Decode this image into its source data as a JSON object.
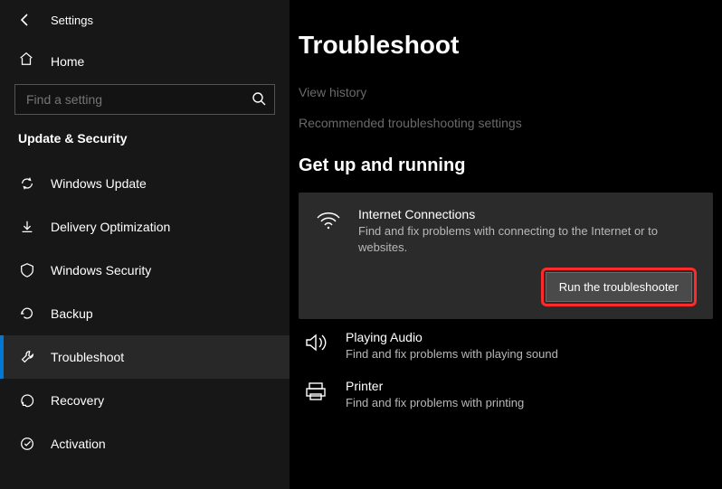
{
  "header": {
    "title": "Settings"
  },
  "home_label": "Home",
  "search": {
    "placeholder": "Find a setting"
  },
  "category": "Update & Security",
  "sidebar": {
    "items": [
      {
        "label": "Windows Update"
      },
      {
        "label": "Delivery Optimization"
      },
      {
        "label": "Windows Security"
      },
      {
        "label": "Backup"
      },
      {
        "label": "Troubleshoot"
      },
      {
        "label": "Recovery"
      },
      {
        "label": "Activation"
      }
    ]
  },
  "main": {
    "title": "Troubleshoot",
    "links": [
      "View history",
      "Recommended troubleshooting settings"
    ],
    "section_title": "Get up and running",
    "expanded": {
      "title": "Internet Connections",
      "desc": "Find and fix problems with connecting to the Internet or to websites.",
      "button": "Run the troubleshooter"
    },
    "items": [
      {
        "title": "Playing Audio",
        "desc": "Find and fix problems with playing sound"
      },
      {
        "title": "Printer",
        "desc": "Find and fix problems with printing"
      }
    ]
  }
}
